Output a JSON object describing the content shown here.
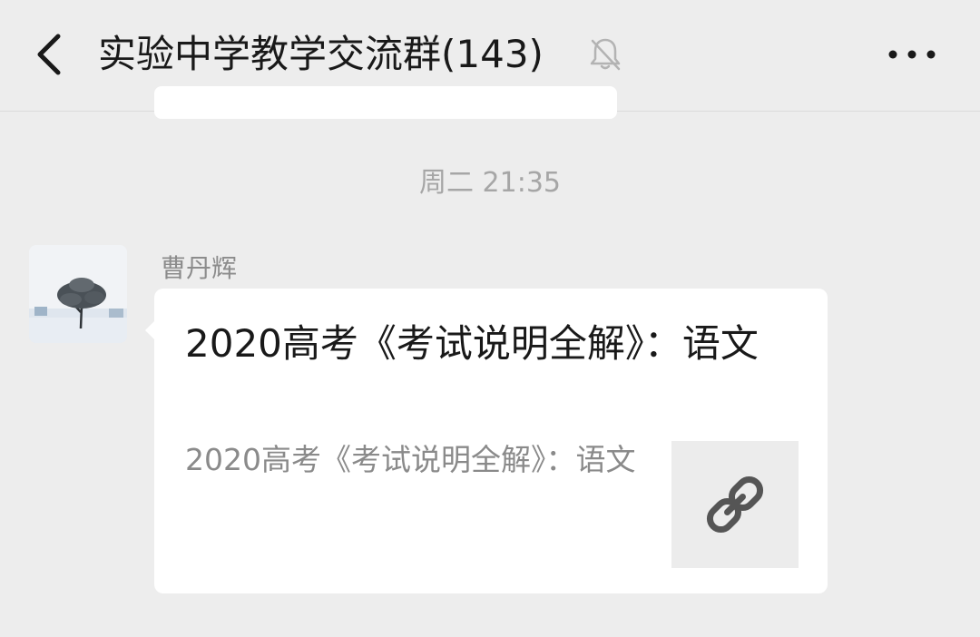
{
  "header": {
    "title": "实验中学教学交流群(143)",
    "back_icon": "chevron-left-icon",
    "mute_icon": "bell-slash-icon",
    "more_icon": "more-dots-icon"
  },
  "messages": {
    "timestamp": "周二 21:35",
    "sender_name": "曹丹辉",
    "avatar_icon": "winter-tree-avatar",
    "link_card": {
      "title": "2020高考《考试说明全解》：语文",
      "description": "2020高考《考试说明全解》：语文",
      "thumb_icon": "link-icon"
    }
  },
  "colors": {
    "background": "#ededed",
    "card": "#ffffff",
    "title_text": "#191919",
    "muted_text": "#a6a6a6"
  }
}
